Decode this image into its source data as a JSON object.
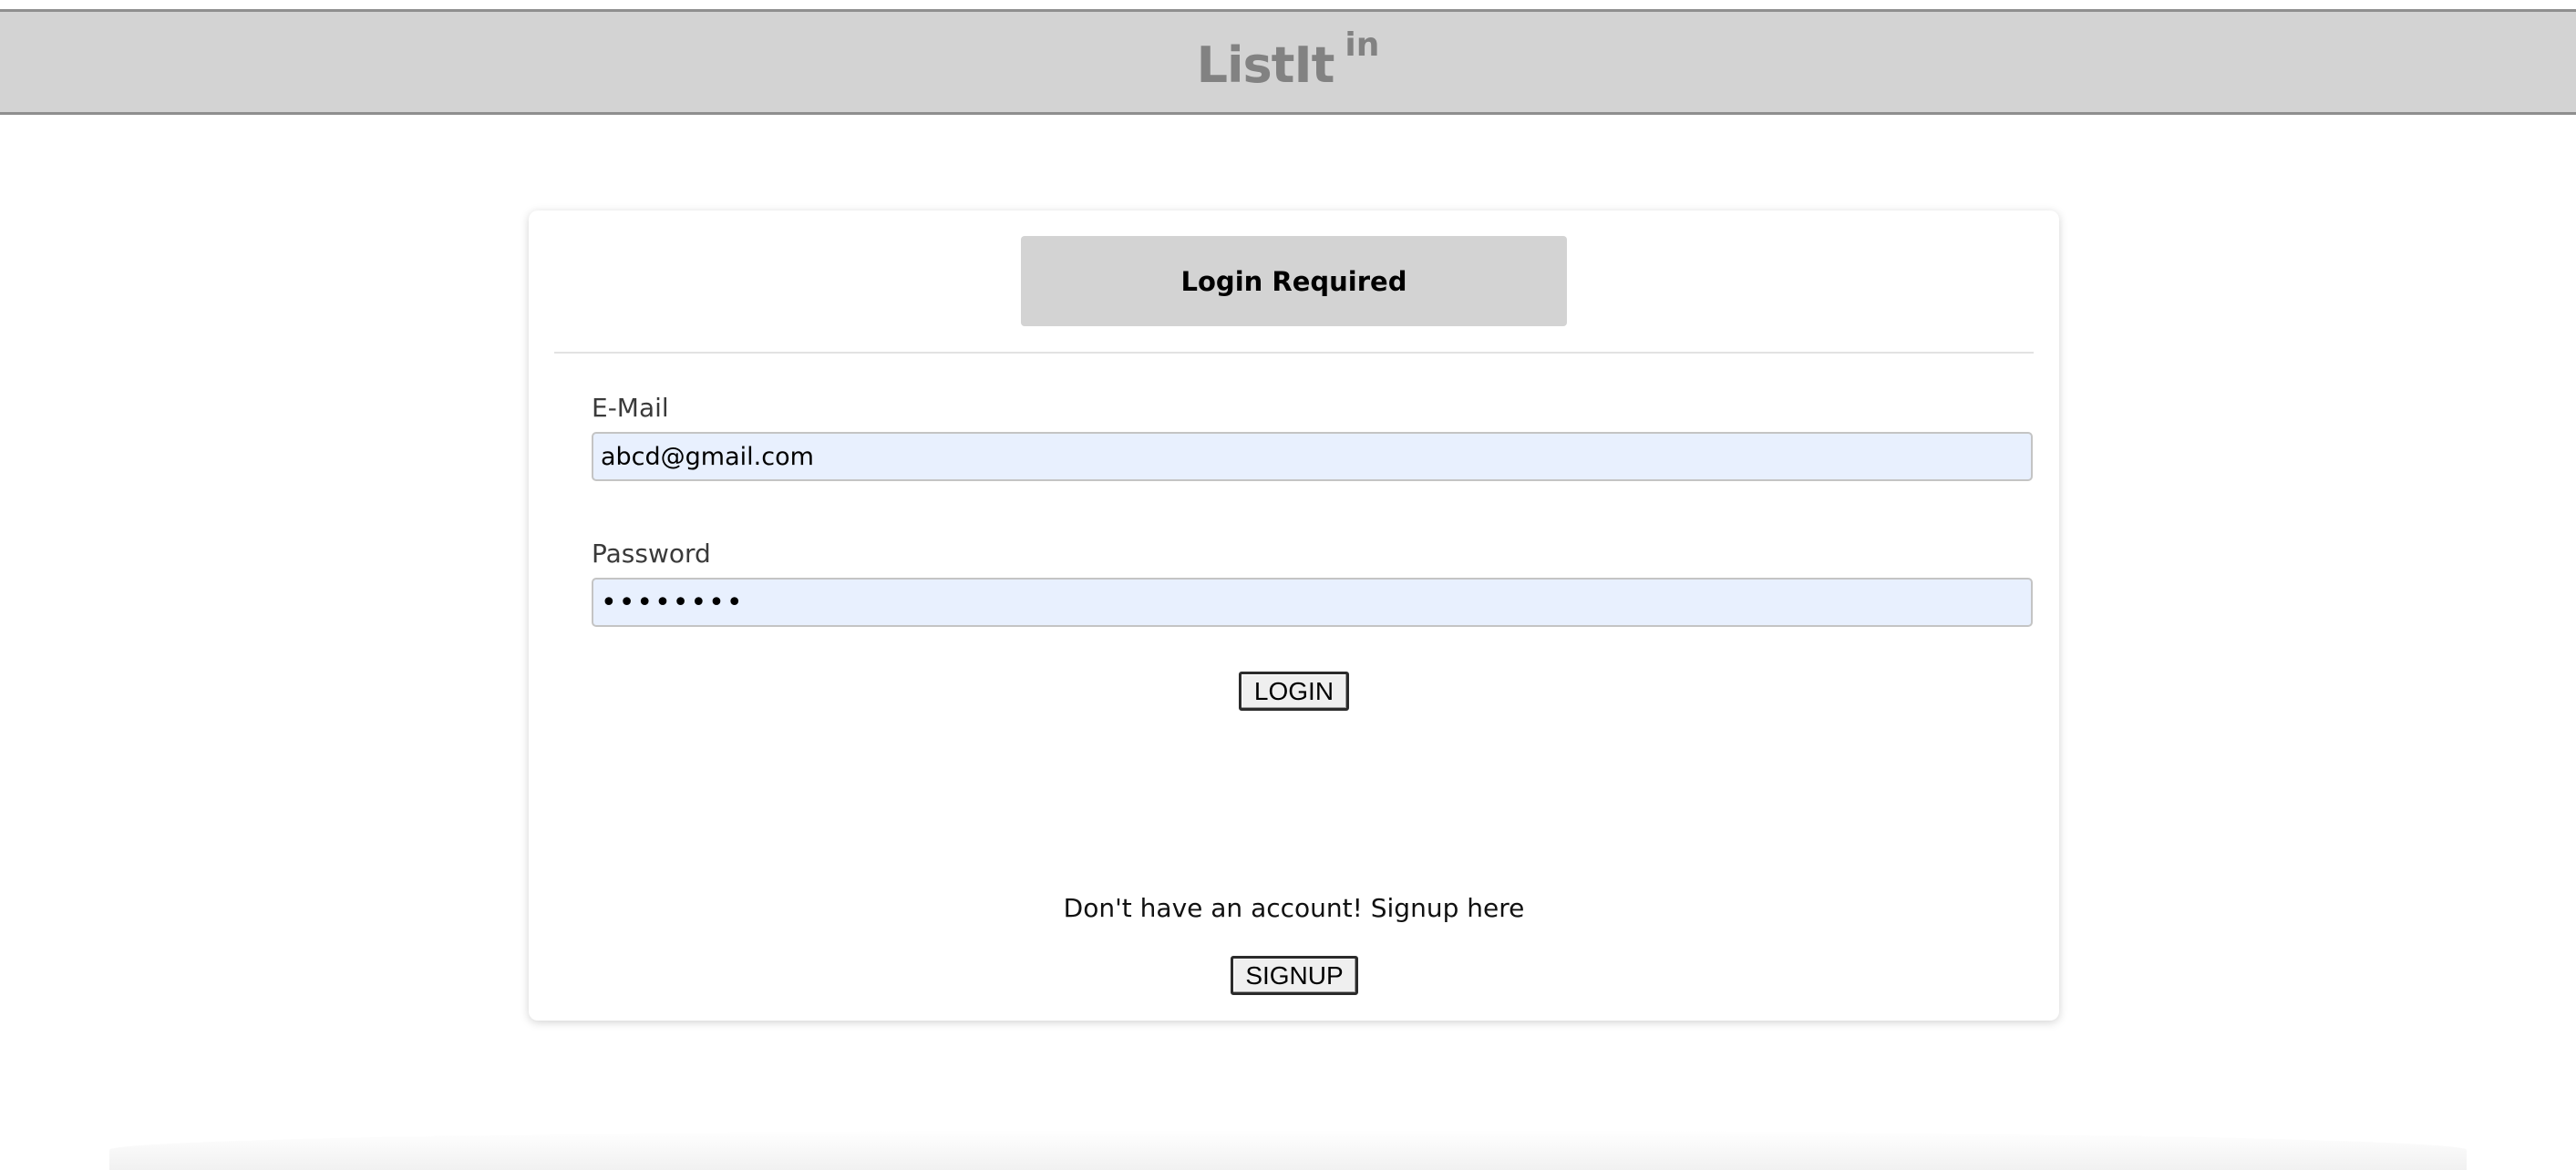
{
  "header": {
    "brand_name": "ListIt",
    "brand_superscript": "in"
  },
  "login_card": {
    "title": "Login Required",
    "email": {
      "label": "E-Mail",
      "value": "abcd@gmail.com"
    },
    "password": {
      "label": "Password",
      "masked_value": "••••••••"
    },
    "login_button_label": "LOGIN",
    "signup_prompt": "Don't have an account! Signup here",
    "signup_button_label": "SIGNUP"
  },
  "colors": {
    "header_bg": "#d3d3d3",
    "brand_text": "#828282",
    "autofill_bg": "#e8f0fe"
  }
}
